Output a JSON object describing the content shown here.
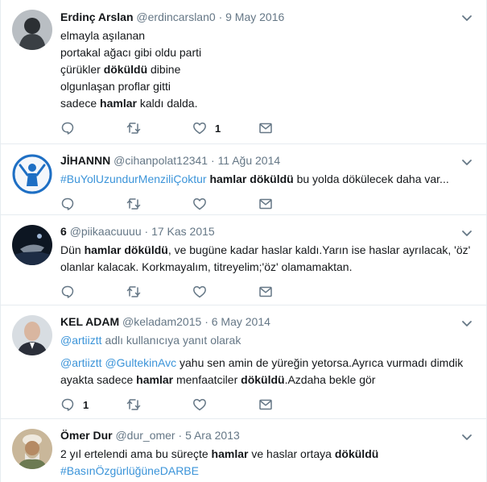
{
  "tweets": [
    {
      "fullname": "Erdinç Arslan",
      "username": "@erdincarslan0",
      "time": "9 May 2016",
      "lines": [
        [
          {
            "t": "elmayla aşılanan"
          }
        ],
        [
          {
            "t": "portakal ağacı gibi oldu parti"
          }
        ],
        [
          {
            "t": "çürükler "
          },
          {
            "t": "döküldü",
            "b": true
          },
          {
            "t": " dibine"
          }
        ],
        [
          {
            "t": "olgunlaşan proflar gitti"
          }
        ],
        [
          {
            "t": "sadece "
          },
          {
            "t": "hamlar",
            "b": true
          },
          {
            "t": " kaldı dalda."
          }
        ]
      ],
      "reply_count": "",
      "like_count": "1"
    },
    {
      "fullname": "JİHANNN",
      "username": "@cihanpolat12341",
      "time": "11 Ağu 2014",
      "lines": [
        [
          {
            "t": "#BuYolUzundurMenziliÇoktur",
            "tag": true
          },
          {
            "t": " "
          },
          {
            "t": "hamlar döküldü",
            "b": true
          },
          {
            "t": " bu yolda dökülecek daha var..."
          }
        ]
      ],
      "reply_count": "",
      "like_count": ""
    },
    {
      "fullname": "6",
      "username": "@piikaacuuuu",
      "time": "17 Kas 2015",
      "lines": [
        [
          {
            "t": "Dün "
          },
          {
            "t": "hamlar döküldü",
            "b": true
          },
          {
            "t": ", ve bugüne kadar haslar kaldı.Yarın ise haslar ayrılacak, 'öz'"
          }
        ],
        [
          {
            "t": "olanlar kalacak. Korkmayalım, titreyelim;'öz' olamamaktan."
          }
        ]
      ],
      "reply_count": "",
      "like_count": ""
    },
    {
      "fullname": "KEL ADAM",
      "username": "@keladam2015",
      "time": "6 May 2014",
      "reply_context": [
        {
          "t": "@artiiztt",
          "tag": true
        },
        {
          "t": " adlı kullanıcıya yanıt olarak"
        }
      ],
      "lines": [
        [
          {
            "t": "@artiiztt @GultekinAvc",
            "tag": true
          },
          {
            "t": " yahu sen amin de yüreğin yetorsa.Ayrıca vurmadı dimdik"
          }
        ],
        [
          {
            "t": "ayakta sadece "
          },
          {
            "t": "hamlar",
            "b": true
          },
          {
            "t": " menfaatciler "
          },
          {
            "t": "döküldü",
            "b": true
          },
          {
            "t": ".Azdaha bekle gör"
          }
        ]
      ],
      "reply_count": "1",
      "like_count": ""
    },
    {
      "fullname": "Ömer Dur",
      "username": "@dur_omer",
      "time": "5 Ara 2013",
      "lines": [
        [
          {
            "t": "2 yıl ertelendi ama bu süreçte "
          },
          {
            "t": "hamlar",
            "b": true
          },
          {
            "t": " ve haslar ortaya "
          },
          {
            "t": "döküldü",
            "b": true
          }
        ],
        [
          {
            "t": "#BasınÖzgürlüğüneDARBE",
            "tag": true
          }
        ]
      ],
      "reply_count": "",
      "like_count": ""
    }
  ],
  "icons": {
    "reply": "reply-icon",
    "retweet": "retweet-icon",
    "like": "heart-icon",
    "dm": "envelope-icon",
    "more": "chevron-down-icon"
  },
  "colors": {
    "link": "#3b94d9",
    "muted": "#657786",
    "text": "#14171a",
    "border": "#e6ecf0"
  }
}
